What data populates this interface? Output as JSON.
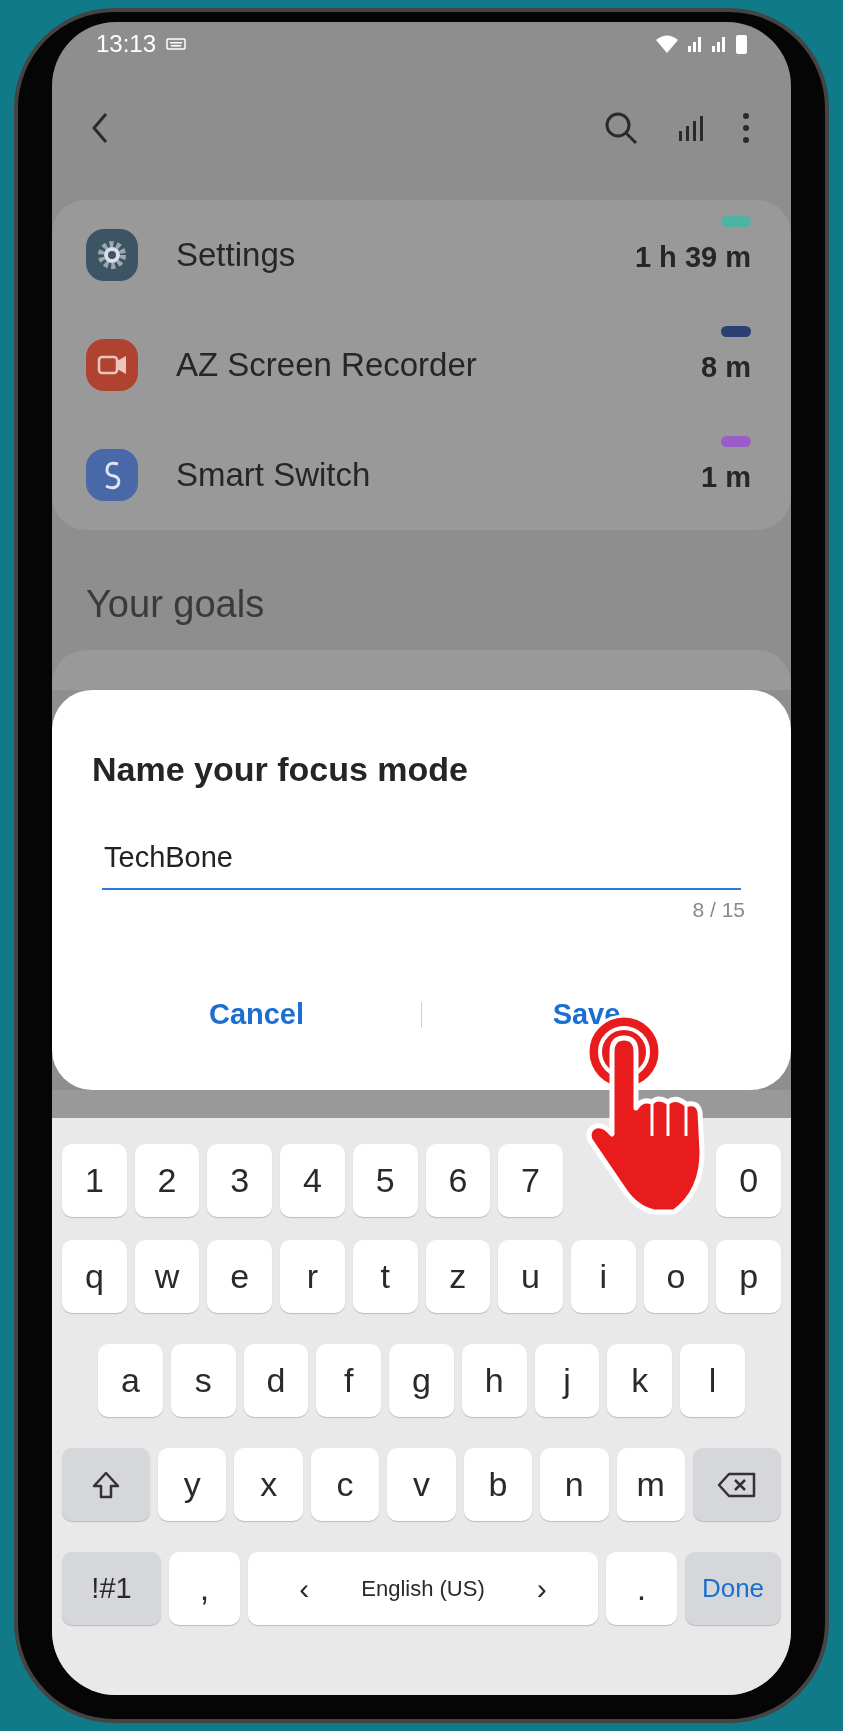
{
  "status_bar": {
    "time": "13:13"
  },
  "app_usage": [
    {
      "name": "Settings",
      "time": "1 h 39 m",
      "color": "#4fb3a3",
      "kind": "gear"
    },
    {
      "name": "AZ Screen Recorder",
      "time": "8 m",
      "color": "#2c3f73",
      "kind": "camera"
    },
    {
      "name": "Smart Switch",
      "time": "1 m",
      "color": "#9a5cc8",
      "kind": "switch"
    }
  ],
  "goals": {
    "heading": "Your goals"
  },
  "dialog": {
    "title": "Name your focus mode",
    "field": {
      "value": "TechBone",
      "counter": "8 / 15"
    },
    "buttons": [
      {
        "label": "Cancel"
      },
      {
        "label": "Save"
      }
    ]
  },
  "keyboard": {
    "rows": [
      {
        "keys": [
          {
            "label": "1"
          },
          {
            "label": "2"
          },
          {
            "label": "3"
          },
          {
            "label": "4"
          },
          {
            "label": "5"
          },
          {
            "label": "6"
          },
          {
            "label": "7"
          },
          {
            "kind": "covered"
          },
          {
            "kind": "covered"
          },
          {
            "label": "0"
          }
        ]
      },
      {
        "keys": [
          {
            "label": "q"
          },
          {
            "label": "w"
          },
          {
            "label": "e"
          },
          {
            "label": "r"
          },
          {
            "label": "t"
          },
          {
            "label": "z"
          },
          {
            "label": "u"
          },
          {
            "label": "i"
          },
          {
            "label": "o"
          },
          {
            "label": "p"
          }
        ]
      },
      {
        "keys": [
          {
            "label": "a"
          },
          {
            "label": "s"
          },
          {
            "label": "d"
          },
          {
            "label": "f"
          },
          {
            "label": "g"
          },
          {
            "label": "h"
          },
          {
            "label": "j"
          },
          {
            "label": "k"
          },
          {
            "label": "l"
          }
        ]
      },
      {
        "keys": [
          {
            "kind": "shift"
          },
          {
            "label": "y"
          },
          {
            "label": "x"
          },
          {
            "label": "c"
          },
          {
            "label": "v"
          },
          {
            "label": "b"
          },
          {
            "label": "n"
          },
          {
            "label": "m"
          },
          {
            "kind": "backspace"
          }
        ]
      },
      {
        "keys": [
          {
            "kind": "mode",
            "label": "!#1"
          },
          {
            "label": ","
          },
          {
            "kind": "space",
            "label": "English (US)",
            "left": "‹",
            "right": "›"
          },
          {
            "label": "."
          },
          {
            "kind": "action",
            "label": "Done"
          }
        ]
      }
    ]
  }
}
